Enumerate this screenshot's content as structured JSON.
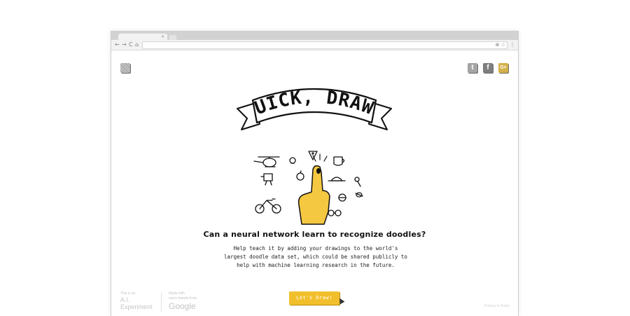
{
  "browser": {
    "tab_close": "×",
    "nav_back": "←",
    "nav_forward": "→",
    "nav_reload": "C",
    "nav_home": "⌂",
    "address_value": "",
    "omni_icons": "⊕ ☆",
    "menu": "⋮"
  },
  "header": {
    "info_icon": "info-icon",
    "share": {
      "twitter_glyph": "t",
      "facebook_glyph": "f",
      "gplus_glyph": "G+"
    }
  },
  "hero": {
    "banner_title": "QUICK, DRAW!"
  },
  "content": {
    "headline": "Can a neural network learn to recognize doodles?",
    "description": "Help teach it by adding your drawings to the world's largest doodle data set, which could be shared publicly to help with machine learning research in the future.",
    "cta_label": "Let's Draw!"
  },
  "footer": {
    "small_a": "This is an",
    "experiment": "A.I.",
    "experiment2": "Experiment",
    "small_b": "Made with",
    "small_c": "some friends from",
    "google": "Google",
    "privacy": "Privacy & Terms"
  },
  "colors": {
    "accent_yellow": "#f2bf2c",
    "hand_yellow": "#f5c842",
    "ink": "#111111"
  }
}
